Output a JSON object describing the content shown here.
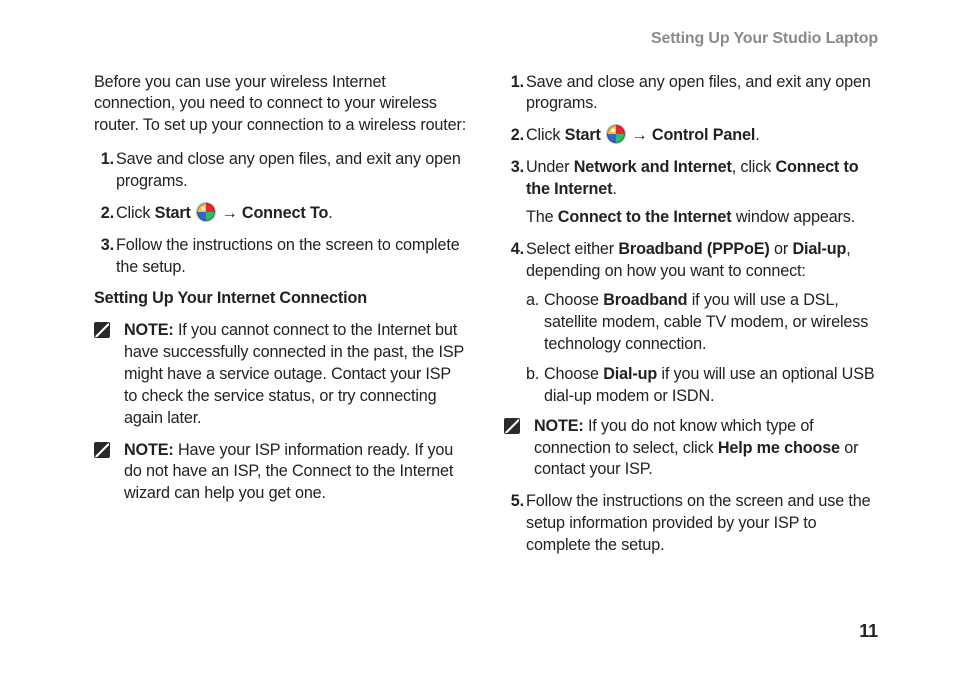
{
  "header": {
    "title": "Setting Up Your Studio Laptop"
  },
  "page_number": "11",
  "left": {
    "intro": "Before you can use your wireless Internet connection, you need to connect to your wireless router. To set up your connection to a wireless router:",
    "steps": {
      "s1_n": "1.",
      "s1": "Save and close any open files, and exit any open programs.",
      "s2_n": "2.",
      "s2_pre": "Click ",
      "s2_start": "Start",
      "s2_arrow": " → ",
      "s2_connect": "Connect To",
      "s2_end": ".",
      "s3_n": "3.",
      "s3": "Follow the instructions on the screen  to complete the setup."
    },
    "subhead": "Setting Up Your Internet Connection",
    "note1_label": "NOTE:",
    "note1": " If you cannot connect to the Internet but have successfully connected in the past, the ISP might have a service outage. Contact your ISP to check the service status, or try connecting again later.",
    "note2_label": "NOTE:",
    "note2": " Have your ISP information ready. If you do not have an ISP, the Connect to the Internet wizard can help you get one."
  },
  "right": {
    "steps": {
      "s1_n": "1.",
      "s1": "Save and close any open files, and exit any open programs.",
      "s2_n": "2.",
      "s2_pre": "Click ",
      "s2_start": "Start",
      "s2_arrow": " → ",
      "s2_cp": "Control Panel",
      "s2_end": ".",
      "s3_n": "3.",
      "s3_pre": "Under ",
      "s3_net": "Network and Internet",
      "s3_mid": ", click ",
      "s3_conn": "Connect to the Internet",
      "s3_end": ".",
      "s3_after_pre": "The ",
      "s3_after_b": "Connect to the Internet",
      "s3_after_end": " window appears.",
      "s4_n": "4.",
      "s4_pre": "Select either ",
      "s4_bb": "Broadband (PPPoE)",
      "s4_or": " or ",
      "s4_du": "Dial-up",
      "s4_end": ", depending on how you want to connect:",
      "s4a_n": "a.",
      "s4a_pre": "Choose ",
      "s4a_b": "Broadband",
      "s4a_end": " if you will use a DSL, satellite modem, cable TV modem, or wireless technology connection.",
      "s4b_n": "b.",
      "s4b_pre": "Choose ",
      "s4b_b": "Dial-up",
      "s4b_end": " if you will use an optional USB dial-up modem or ISDN.",
      "note_label": "NOTE:",
      "note_pre": " If you do not know which type of connection to select, click ",
      "note_b": "Help me choose",
      "note_end": " or contact your ISP.",
      "s5_n": "5.",
      "s5": "Follow the instructions on the screen and use the setup information provided by your ISP to complete the setup."
    }
  }
}
